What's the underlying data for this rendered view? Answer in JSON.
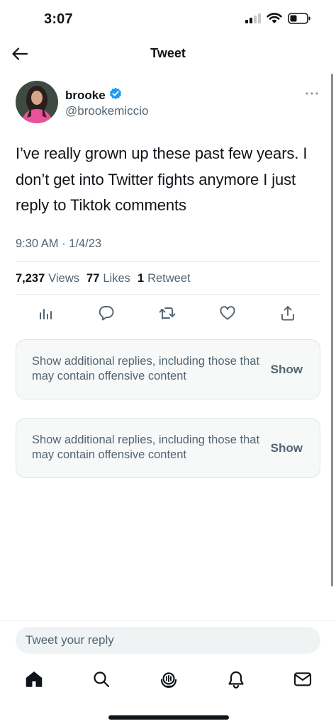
{
  "status_bar": {
    "time": "3:07"
  },
  "header": {
    "title": "Tweet"
  },
  "tweet": {
    "author_name": "brooke",
    "author_handle": "@brookemiccio",
    "verified": true,
    "text": "I’ve really grown up these past few years. I don’t get into Twitter fights anymore I just reply to Tiktok comments",
    "timestamp": "9:30 AM · 1/4/23",
    "stats": {
      "views_count": "7,237",
      "views_label": "Views",
      "likes_count": "77",
      "likes_label": "Likes",
      "retweets_count": "1",
      "retweets_label": "Retweet"
    },
    "actions": [
      "analytics-icon",
      "reply-icon",
      "retweet-icon",
      "like-icon",
      "share-icon"
    ]
  },
  "hidden_replies": [
    {
      "text": "Show additional replies, including those that may contain offensive content",
      "button": "Show"
    },
    {
      "text": "Show additional replies, including those that may contain offensive content",
      "button": "Show"
    }
  ],
  "reply_box": {
    "placeholder": "Tweet your reply"
  },
  "tabs": [
    "home-icon",
    "search-icon",
    "spaces-icon",
    "notifications-icon",
    "messages-icon"
  ],
  "colors": {
    "text": "#0f1419",
    "secondary": "#536471",
    "verified": "#1d9bf0",
    "card_bg": "#f7f9f9"
  }
}
